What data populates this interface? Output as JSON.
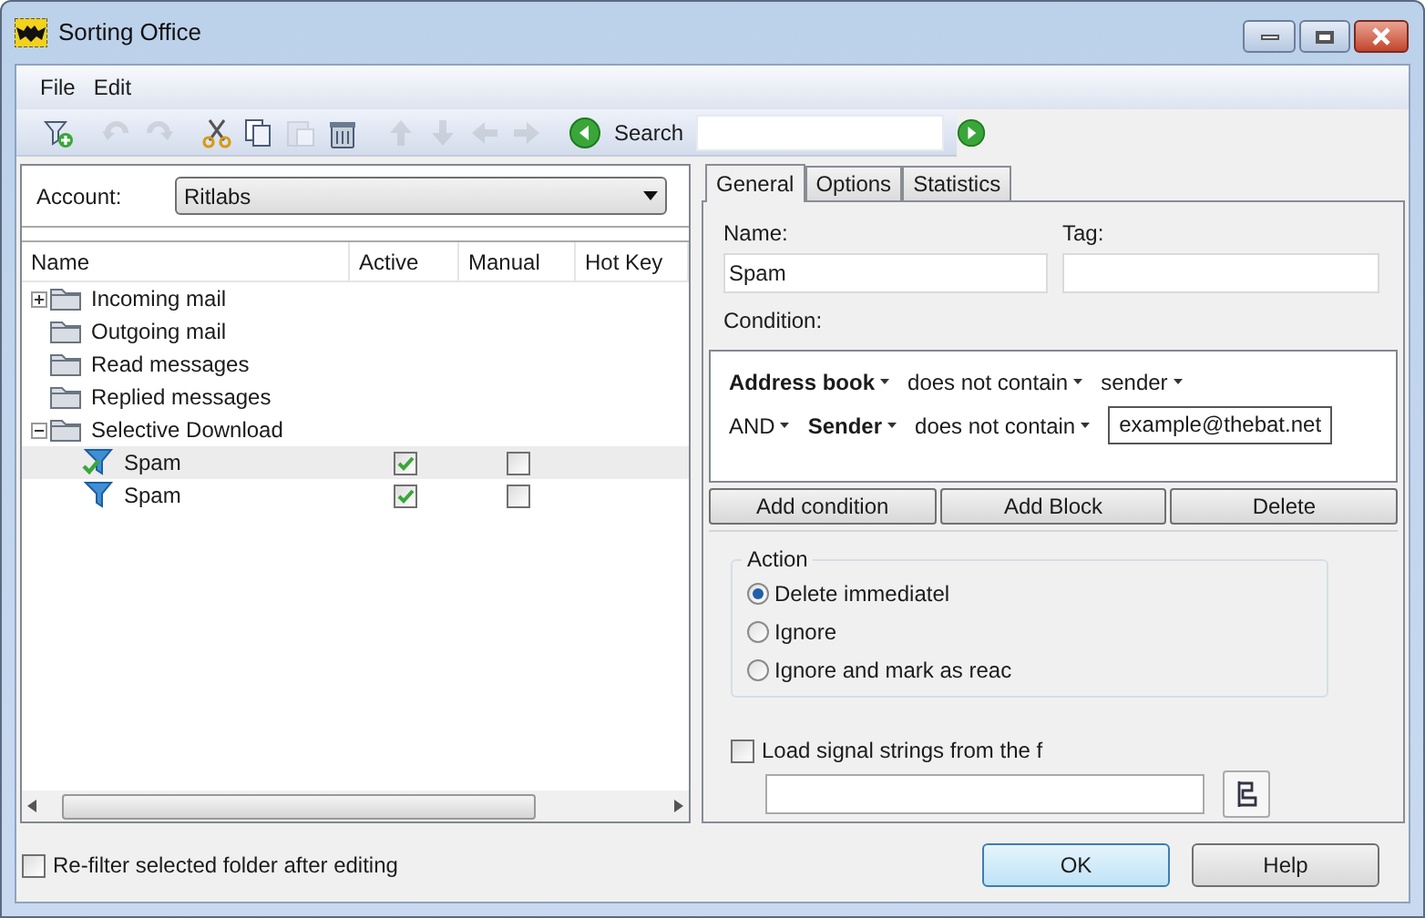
{
  "window": {
    "title": "Sorting Office"
  },
  "menu": [
    {
      "label": "File"
    },
    {
      "label": "Edit"
    }
  ],
  "toolbar": {
    "buttons": [
      {
        "kind": "new-filter",
        "disabled": false
      },
      {
        "kind": "undo",
        "disabled": true
      },
      {
        "kind": "redo",
        "disabled": true
      },
      {
        "kind": "cut",
        "disabled": false
      },
      {
        "kind": "copy",
        "disabled": false
      },
      {
        "kind": "paste",
        "disabled": true
      },
      {
        "kind": "delete",
        "disabled": false
      },
      {
        "kind": "up",
        "disabled": true
      },
      {
        "kind": "down",
        "disabled": true
      },
      {
        "kind": "left",
        "disabled": true
      },
      {
        "kind": "right",
        "disabled": true
      },
      {
        "kind": "back",
        "disabled": false
      }
    ],
    "search_label": "Search"
  },
  "account": {
    "label": "Account:",
    "value": "Ritlabs"
  },
  "tree": {
    "columns": [
      "Name",
      "Active",
      "Manual",
      "Hot Key"
    ],
    "items": [
      {
        "kind": "folder",
        "label": "Incoming mail",
        "expanded": false,
        "selected": false
      },
      {
        "kind": "folder",
        "label": "Outgoing mail",
        "selected": false
      },
      {
        "kind": "folder",
        "label": "Read messages",
        "selected": false
      },
      {
        "kind": "folder",
        "label": "Replied messages",
        "selected": false
      },
      {
        "kind": "folder",
        "label": "Selective Download",
        "expanded": true,
        "selected": false,
        "children": [
          {
            "kind": "filter-checked",
            "label": "Spam",
            "active": true,
            "manual": false,
            "selected": true
          },
          {
            "kind": "filter",
            "label": "Spam",
            "active": true,
            "manual": false,
            "selected": false
          }
        ]
      }
    ]
  },
  "tabs": [
    {
      "label": "General",
      "selected": true
    },
    {
      "label": "Options",
      "selected": false
    },
    {
      "label": "Statistics",
      "selected": false
    }
  ],
  "name_field": {
    "label": "Name:",
    "value": "Spam"
  },
  "tag_field": {
    "label": "Tag:"
  },
  "condition": {
    "label": "Condition:",
    "lines": [
      [
        {
          "kind": "menu",
          "text": "Address book",
          "bold": true
        },
        {
          "kind": "menu",
          "text": "does not contain",
          "bold": false
        },
        {
          "kind": "menu",
          "text": "sender",
          "bold": false
        }
      ],
      [
        {
          "kind": "menu",
          "text": "AND",
          "bold": false
        },
        {
          "kind": "menu",
          "text": "Sender",
          "bold": true
        },
        {
          "kind": "menu",
          "text": "does not contain",
          "bold": false
        },
        {
          "kind": "field",
          "text": "example@thebat.net"
        }
      ]
    ]
  },
  "condition_buttons": [
    "Add condition",
    "Add Block",
    "Delete"
  ],
  "action": {
    "title": "Action",
    "options": [
      {
        "label": "Delete immediatel",
        "selected": true
      },
      {
        "label": "Ignore",
        "selected": false
      },
      {
        "label": "Ignore and mark as reac",
        "selected": false
      }
    ]
  },
  "load_signal": {
    "label": "Load signal strings from the f",
    "checked": false
  },
  "refilter": {
    "label": "Re-filter selected folder after editing",
    "checked": false
  },
  "buttons": [
    {
      "label": "OK",
      "default": true
    },
    {
      "label": "Help",
      "default": false
    }
  ]
}
